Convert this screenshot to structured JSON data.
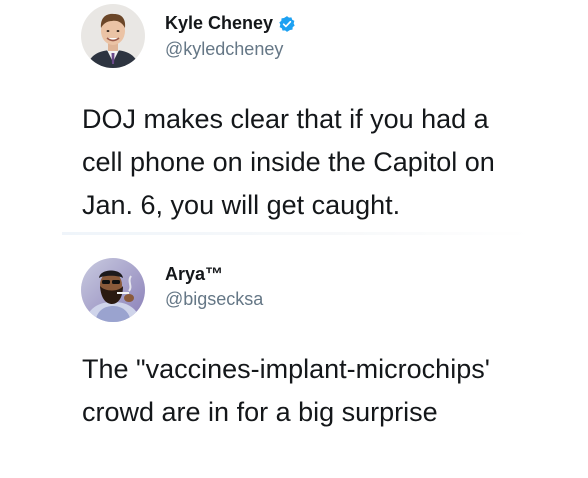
{
  "tweets": [
    {
      "display_name": "Kyle Cheney",
      "handle": "@kyledcheney",
      "verified": true,
      "text_lines": [
        "DOJ makes clear that if you had a",
        "cell phone on inside the Capitol on",
        "Jan. 6, you will get caught."
      ],
      "avatar_icon": "avatar-photo-man-in-suit"
    },
    {
      "display_name": "Arya™",
      "handle": "@bigsecksa",
      "verified": false,
      "text_lines": [
        "The \"vaccines-implant-microchips'",
        "crowd are in for a big surprise"
      ],
      "avatar_icon": "avatar-photo-bearded-man-smoking"
    }
  ],
  "colors": {
    "text": "#14171a",
    "handle": "#657786",
    "verified": "#1da1f2"
  }
}
